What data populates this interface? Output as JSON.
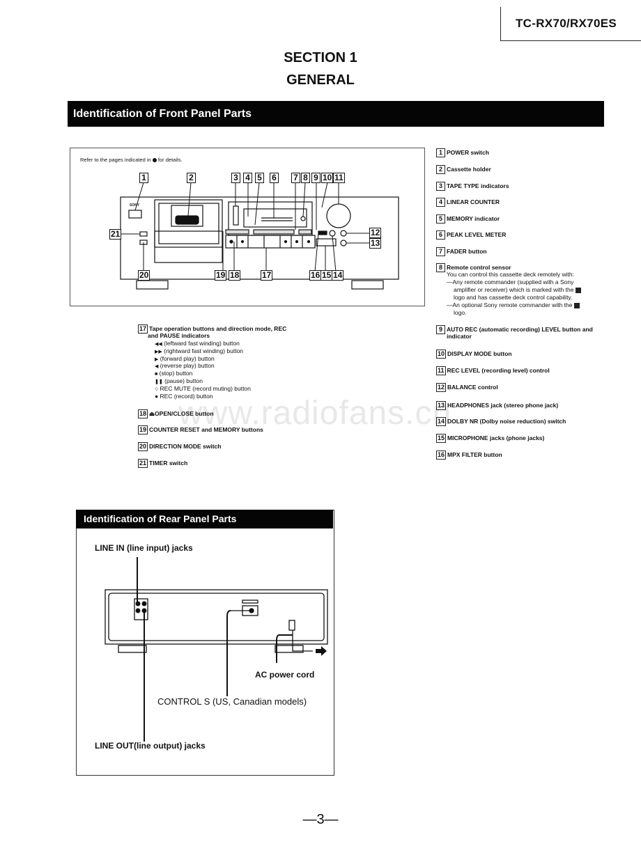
{
  "header": {
    "model": "TC-RX70/RX70ES"
  },
  "section": {
    "number_line": "SECTION 1",
    "title": "GENERAL"
  },
  "front_panel": {
    "heading": "Identification of Front Panel Parts",
    "refer_note_prefix": "Refer to the pages indicated in",
    "refer_note_suffix": "for details.",
    "brand_on_device": "SONY",
    "callouts_top": [
      "1",
      "2",
      "3",
      "4",
      "5",
      "6",
      "7",
      "8",
      "9",
      "10",
      "11"
    ],
    "callouts_right": [
      "12",
      "13"
    ],
    "callouts_left": [
      "21"
    ],
    "callouts_bottom": [
      "20",
      "19",
      "18",
      "17",
      "16",
      "15",
      "14"
    ],
    "parts_right": [
      {
        "num": "1",
        "label": "POWER switch"
      },
      {
        "num": "2",
        "label": "Cassette holder"
      },
      {
        "num": "3",
        "label": "TAPE TYPE indicators"
      },
      {
        "num": "4",
        "label": "LINEAR COUNTER"
      },
      {
        "num": "5",
        "label": "MEMORY indicator"
      },
      {
        "num": "6",
        "label": "PEAK LEVEL METER"
      },
      {
        "num": "7",
        "label": "FADER button"
      },
      {
        "num": "8",
        "label": "Remote control sensor",
        "details": [
          "You can control this cassette deck remotely with:",
          "—Any remote commander (supplied with a Sony",
          "amplifier or receiver) which is marked with the",
          "logo and has cassette deck control capability.",
          "—An optional Sony remote commander with the",
          "logo."
        ]
      },
      {
        "num": "9",
        "label": "AUTO REC (automatic recording) LEVEL button and",
        "label_line2": "indicator"
      },
      {
        "num": "10",
        "label": "DISPLAY MODE button"
      },
      {
        "num": "11",
        "label": "REC LEVEL (recording level) control"
      },
      {
        "num": "12",
        "label": "BALANCE control"
      },
      {
        "num": "13",
        "label": "HEADPHONES jack (stereo phone jack)"
      },
      {
        "num": "14",
        "label": "DOLBY NR (Dolby noise reduction) switch"
      },
      {
        "num": "15",
        "label": "MICROPHONE jacks (phone jacks)"
      },
      {
        "num": "16",
        "label": "MPX FILTER button"
      }
    ],
    "parts_left": [
      {
        "num": "17",
        "label": "Tape operation buttons and direction mode, REC",
        "label_line2": "and PAUSE indicators",
        "sub": [
          {
            "icon": "◀◀",
            "text": "(leftward fast winding) button"
          },
          {
            "icon": "▶▶",
            "text": "(rightward fast winding) button"
          },
          {
            "icon": "▶",
            "text": "(forward play) button"
          },
          {
            "icon": "◀",
            "text": "(reverse play) button"
          },
          {
            "icon": "■",
            "text": "(stop) button"
          },
          {
            "icon": "❚❚",
            "text": "(pause) button"
          },
          {
            "icon": "○",
            "text": "REC MUTE (record muting) button"
          },
          {
            "icon": "●",
            "text": "REC (record) button"
          }
        ]
      },
      {
        "num": "18",
        "icon": "⏏",
        "label": "OPEN/CLOSE button"
      },
      {
        "num": "19",
        "label": "COUNTER RESET and MEMORY buttons"
      },
      {
        "num": "20",
        "label": "DIRECTION MODE switch"
      },
      {
        "num": "21",
        "label": "TIMER switch"
      }
    ]
  },
  "rear_panel": {
    "heading": "Identification of Rear Panel Parts",
    "labels": {
      "line_in": "LINE IN (line input) jacks",
      "ac_power": "AC power cord",
      "control_s": "CONTROL S  (US, Canadian models)",
      "line_out": "LINE OUT(line output) jacks"
    }
  },
  "watermark": "www.radiofans.cn",
  "page_number": "—3—"
}
